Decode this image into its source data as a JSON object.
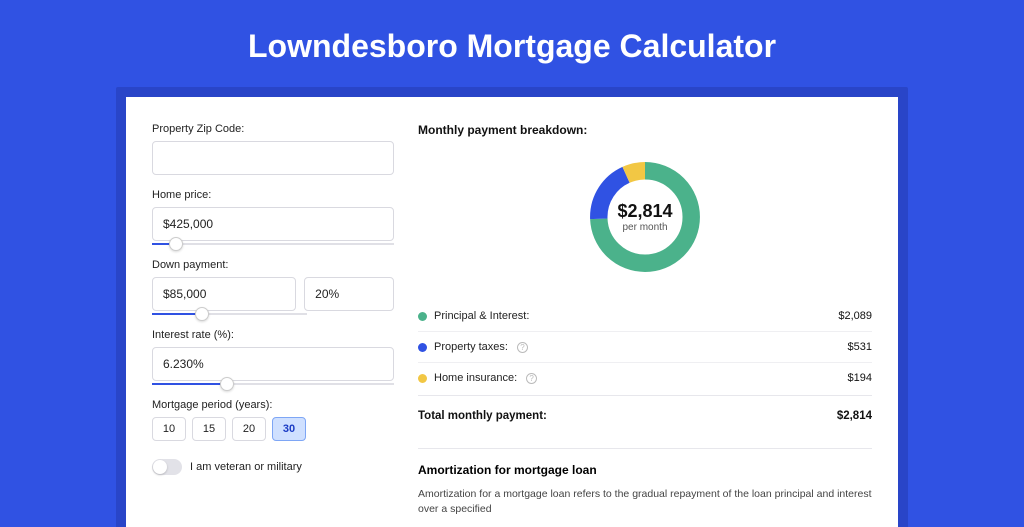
{
  "title": "Lowndesboro Mortgage Calculator",
  "form": {
    "zip_label": "Property Zip Code:",
    "zip_value": "",
    "home_price_label": "Home price:",
    "home_price_value": "$425,000",
    "down_payment_label": "Down payment:",
    "down_payment_amount": "$85,000",
    "down_payment_pct": "20%",
    "interest_label": "Interest rate (%):",
    "interest_value": "6.230%",
    "period_label": "Mortgage period (years):",
    "periods": [
      "10",
      "15",
      "20",
      "30"
    ],
    "period_active": "30",
    "veteran_label": "I am veteran or military"
  },
  "breakdown": {
    "title": "Monthly payment breakdown:",
    "center_value": "$2,814",
    "center_sub": "per month",
    "items": [
      {
        "label": "Principal & Interest:",
        "value": "$2,089",
        "color": "#4bb28b",
        "info": false
      },
      {
        "label": "Property taxes:",
        "value": "$531",
        "color": "#3052e3",
        "info": true
      },
      {
        "label": "Home insurance:",
        "value": "$194",
        "color": "#f2c744",
        "info": true
      }
    ],
    "total_label": "Total monthly payment:",
    "total_value": "$2,814"
  },
  "amortization": {
    "title": "Amortization for mortgage loan",
    "text": "Amortization for a mortgage loan refers to the gradual repayment of the loan principal and interest over a specified"
  },
  "chart_data": {
    "type": "pie",
    "title": "Monthly payment breakdown",
    "series": [
      {
        "name": "Principal & Interest",
        "value": 2089,
        "color": "#4bb28b"
      },
      {
        "name": "Property taxes",
        "value": 531,
        "color": "#3052e3"
      },
      {
        "name": "Home insurance",
        "value": 194,
        "color": "#f2c744"
      }
    ],
    "total": 2814,
    "center_label": "$2,814 per month"
  }
}
